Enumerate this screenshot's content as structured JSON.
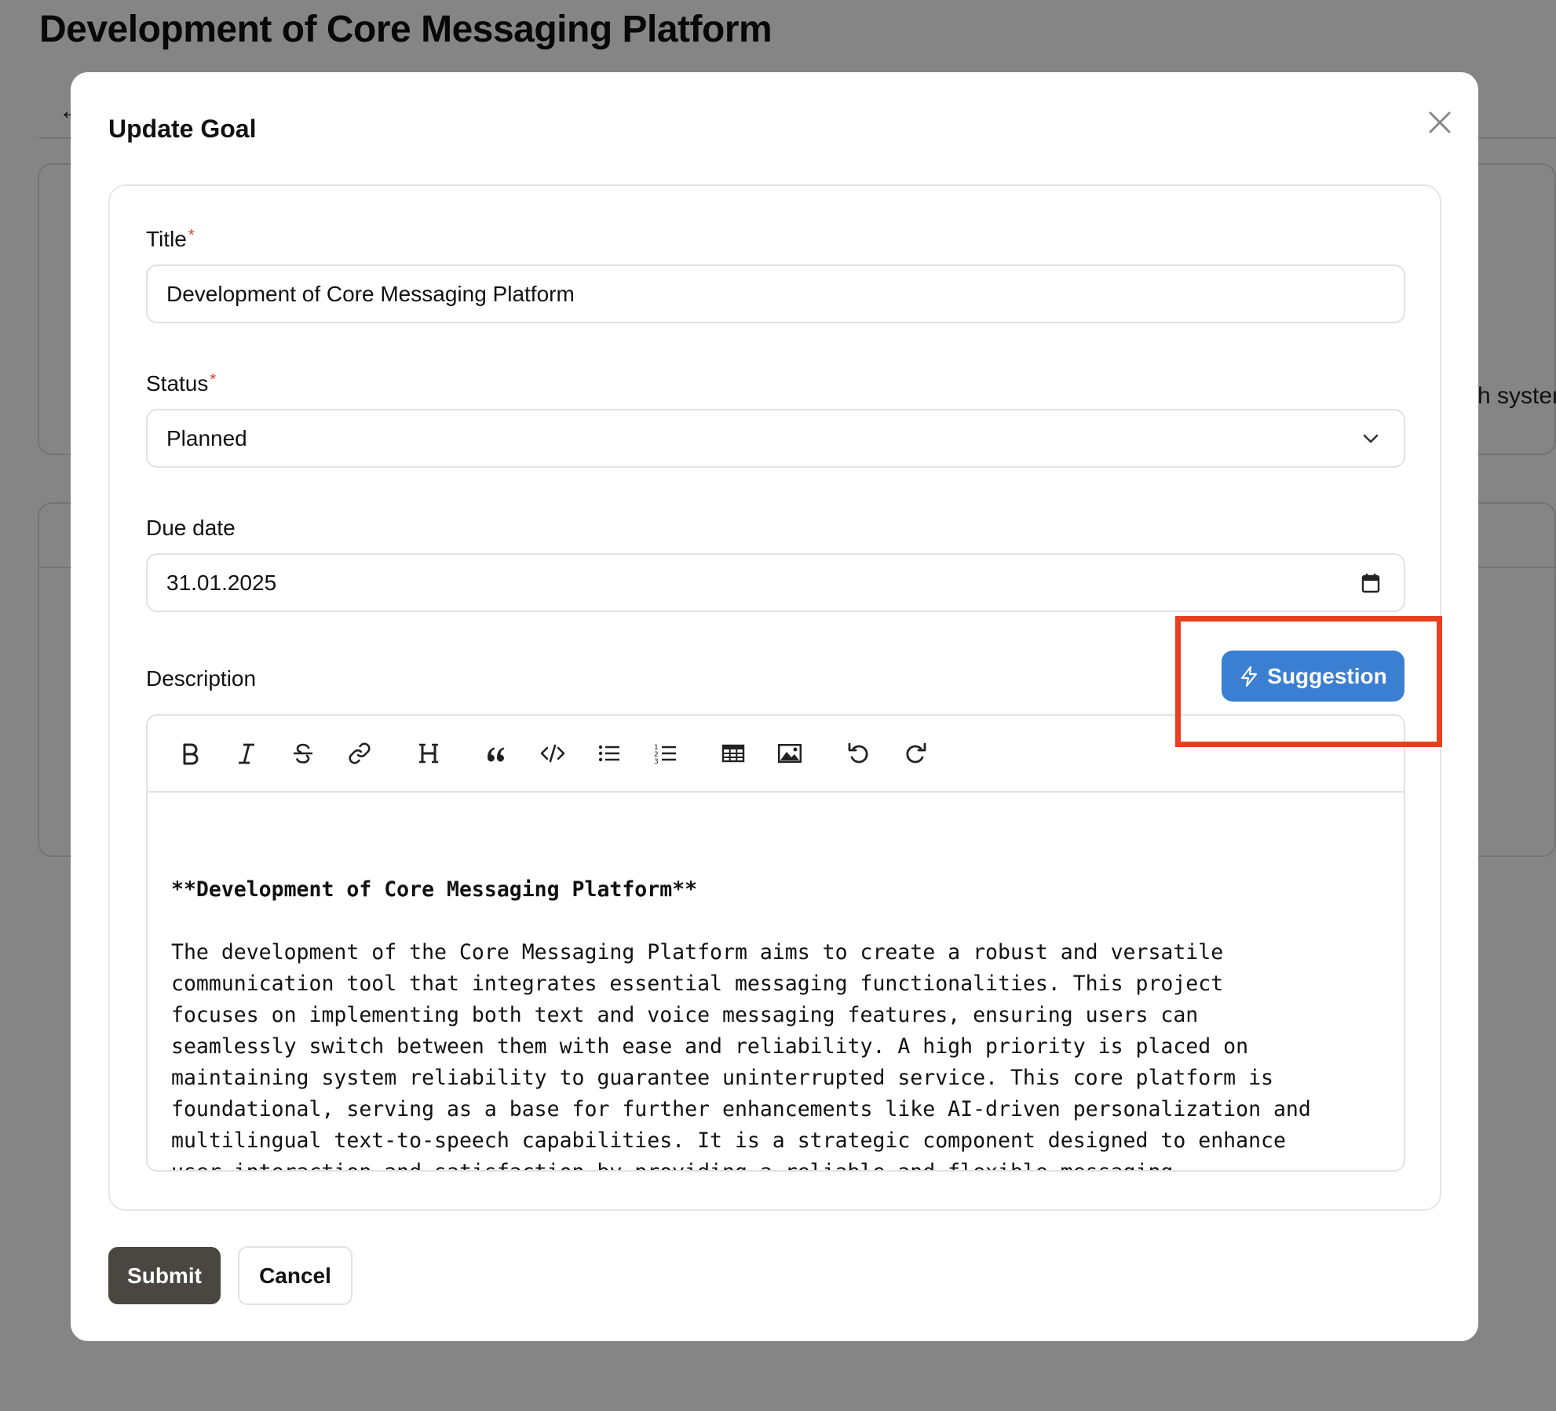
{
  "background": {
    "page_title": "Development of Core Messaging Platform",
    "peek_text": "h system"
  },
  "modal": {
    "title": "Update Goal",
    "fields": {
      "title_label": "Title",
      "title_value": "Development of Core Messaging Platform",
      "status_label": "Status",
      "status_value": "Planned",
      "due_label": "Due date",
      "due_value": "31.01.2025",
      "description_label": "Description",
      "required_mark": "*"
    },
    "suggestion_label": "Suggestion",
    "toolbar": {
      "icons": [
        "bold-icon",
        "italic-icon",
        "strikethrough-icon",
        "link-icon",
        "heading-icon",
        "quote-icon",
        "code-icon",
        "bullet-list-icon",
        "numbered-list-icon",
        "table-icon",
        "image-icon",
        "undo-icon",
        "redo-icon"
      ]
    },
    "description": {
      "heading": "**Development of Core Messaging Platform**",
      "body": "The development of the Core Messaging Platform aims to create a robust and versatile\ncommunication tool that integrates essential messaging functionalities. This project\nfocuses on implementing both text and voice messaging features, ensuring users can\nseamlessly switch between them with ease and reliability. A high priority is placed on\nmaintaining system reliability to guarantee uninterrupted service. This core platform is\nfoundational, serving as a base for further enhancements like AI-driven personalization and\nmultilingual text-to-speech capabilities. It is a strategic component designed to enhance\nuser interaction and satisfaction by providing a reliable and flexible messaging\nexperience."
    },
    "submit_label": "Submit",
    "cancel_label": "Cancel"
  },
  "colors": {
    "accent": "#3a7fd1",
    "highlight": "#e8401f",
    "required": "#e53935",
    "submit_bg": "#4a4641"
  }
}
